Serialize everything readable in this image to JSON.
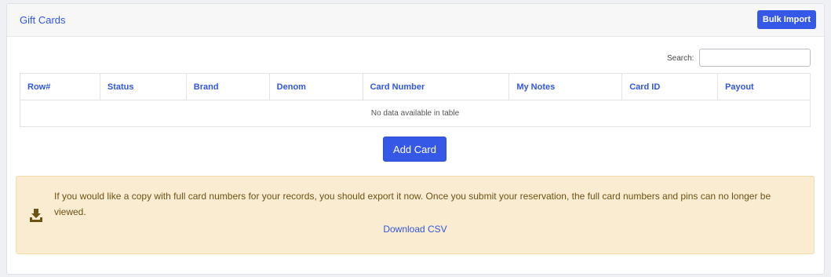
{
  "header": {
    "title": "Gift Cards",
    "bulk_import_label": "Bulk Import"
  },
  "search": {
    "label": "Search:",
    "value": ""
  },
  "table": {
    "columns": [
      "Row#",
      "Status",
      "Brand",
      "Denom",
      "Card Number",
      "My Notes",
      "Card ID",
      "Payout"
    ],
    "empty_message": "No data available in table"
  },
  "add_card_label": "Add Card",
  "notice": {
    "icon": "download-icon",
    "message": "If you would like a copy with full card numbers for your records, you should export it now. Once you submit your reservation, the full card numbers and pins can no longer be viewed.",
    "link_label": "Download CSV"
  },
  "colors": {
    "accent": "#3558e6",
    "link": "#2f56e4",
    "notice_bg": "#faecd0",
    "notice_text": "#6d5216"
  }
}
